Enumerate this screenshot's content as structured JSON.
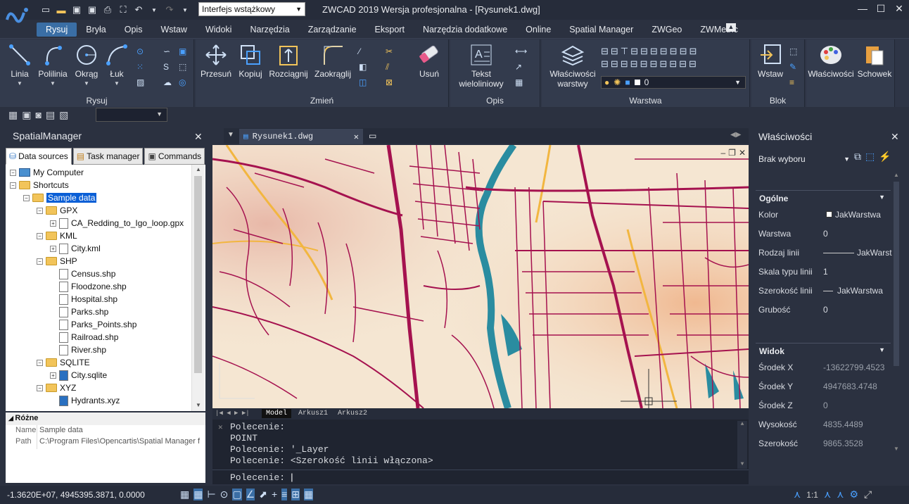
{
  "app": {
    "title": "ZWCAD 2019 Wersja profesjonalna - [Rysunek1.dwg]",
    "workspace": "Interfejs wstążkowy"
  },
  "ribbon_tabs": [
    "Rysuj",
    "Bryła",
    "Opis",
    "Wstaw",
    "Widoki",
    "Narzędzia",
    "Zarządzanie",
    "Eksport",
    "Narzędzia dodatkowe",
    "Online",
    "Spatial Manager",
    "ZWGeo",
    "ZWMetric"
  ],
  "ribbon": {
    "rysuj": {
      "label": "Rysuj",
      "linia": "Linia",
      "polilinia": "Polilinia",
      "okrag": "Okrąg",
      "luk": "Łuk"
    },
    "zmien": {
      "label": "Zmień",
      "przesun": "Przesuń",
      "kopiuj": "Kopiuj",
      "rozciagnij": "Rozciągnij",
      "zaokraglij": "Zaokrąglij",
      "usun": "Usuń"
    },
    "opis": {
      "label": "Opis",
      "tekst1": "Tekst",
      "tekst2": "wieloliniowy"
    },
    "warstwa": {
      "label": "Warstwa",
      "wlasciwosci1": "Właściwości",
      "wlasciwosci2": "warstwy",
      "current_layer": "0"
    },
    "blok": {
      "label": "Blok",
      "wstaw": "Wstaw"
    },
    "extra": {
      "wlasciwosci": "Właściwości",
      "schowek": "Schowek"
    }
  },
  "left_panel": {
    "title": "SpatialManager",
    "tabs": [
      "Data sources",
      "Task manager",
      "Commands"
    ],
    "tree": [
      {
        "label": "My Computer",
        "level": 0
      },
      {
        "label": "Shortcuts",
        "level": 0
      },
      {
        "label": "Sample data",
        "level": 1
      },
      {
        "label": "GPX",
        "level": 2
      },
      {
        "label": "CA_Redding_to_Igo_loop.gpx",
        "level": 3
      },
      {
        "label": "KML",
        "level": 2
      },
      {
        "label": "City.kml",
        "level": 3
      },
      {
        "label": "SHP",
        "level": 2
      },
      {
        "label": "Census.shp",
        "level": 3
      },
      {
        "label": "Floodzone.shp",
        "level": 3
      },
      {
        "label": "Hospital.shp",
        "level": 3
      },
      {
        "label": "Parks.shp",
        "level": 3
      },
      {
        "label": "Parks_Points.shp",
        "level": 3
      },
      {
        "label": "Railroad.shp",
        "level": 3
      },
      {
        "label": "River.shp",
        "level": 3
      },
      {
        "label": "SQLITE",
        "level": 2
      },
      {
        "label": "City.sqlite",
        "level": 3
      },
      {
        "label": "XYZ",
        "level": 2
      },
      {
        "label": "Hydrants.xyz",
        "level": 3
      }
    ],
    "props_title": "Różne",
    "props": {
      "name_label": "Name",
      "name_value": "Sample data",
      "path_label": "Path",
      "path_value": "C:\\Program Files\\Opencartis\\Spatial Manager f"
    }
  },
  "document": {
    "tab": "Rysunek1.dwg",
    "layout_tabs": [
      "Model",
      "Arkusz1",
      "Arkusz2"
    ]
  },
  "command": {
    "lines": [
      "Polecenie:",
      "POINT",
      "Polecenie: '_Layer",
      "Polecenie:  <Szerokość linii włączona>"
    ],
    "prompt": "Polecenie:"
  },
  "right_panel": {
    "title": "Właściwości",
    "selection": "Brak wyboru",
    "general": "Ogólne",
    "general_rows": [
      {
        "label": "Kolor",
        "value": "JakWarstwa"
      },
      {
        "label": "Warstwa",
        "value": "0"
      },
      {
        "label": "Rodzaj linii",
        "value": "JakWarst"
      },
      {
        "label": "Skala typu linii",
        "value": "1"
      },
      {
        "label": "Szerokość linii",
        "value": "JakWarstwa"
      },
      {
        "label": "Grubość",
        "value": "0"
      }
    ],
    "view": "Widok",
    "view_rows": [
      {
        "label": "Środek X",
        "value": "-13622799.4523"
      },
      {
        "label": "Środek Y",
        "value": "4947683.4748"
      },
      {
        "label": "Środek Z",
        "value": "0"
      },
      {
        "label": "Wysokość",
        "value": "4835.4489"
      },
      {
        "label": "Szerokość",
        "value": "9865.3528"
      }
    ]
  },
  "status": {
    "coords": "-1.3620E+07, 4945395.3871, 0.0000",
    "scale": "1:1"
  },
  "colors": {
    "accent": "#3a6ea5",
    "selection": "#0a5fd6",
    "roads": "#a5124f",
    "river": "#2a8ca0"
  }
}
